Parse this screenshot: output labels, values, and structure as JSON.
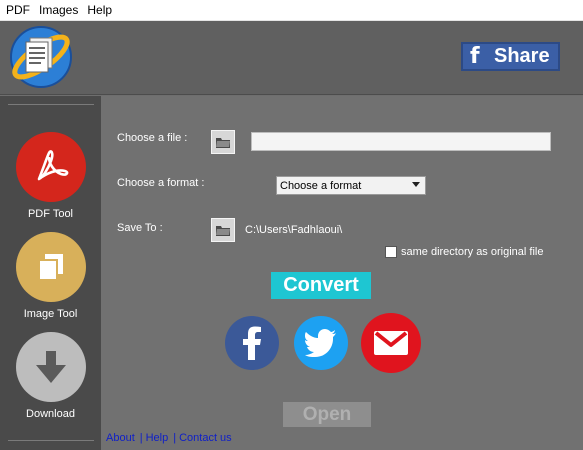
{
  "menu": [
    "PDF",
    "Images",
    "Help"
  ],
  "header": {
    "share_label": "Share",
    "share_icon": "facebook-f-icon"
  },
  "sidebar": {
    "tools": [
      {
        "label": "PDF Tool",
        "icon": "acrobat-icon",
        "color": "#d4261c"
      },
      {
        "label": "Image Tool",
        "icon": "copy-icon",
        "color": "#d8b05a"
      },
      {
        "label": "Download",
        "icon": "download-arrow-icon",
        "color": "#bdbdbd"
      }
    ]
  },
  "form": {
    "choose_file_label": "Choose a file :",
    "file_value": "",
    "choose_format_label": "Choose a format :",
    "format_selected": "Choose a format",
    "save_to_label": "Save To :",
    "save_path": "C:\\Users\\Fadhlaoui\\",
    "same_dir_label": "same directory as original file",
    "same_dir_checked": false
  },
  "actions": {
    "convert_label": "Convert",
    "open_label": "Open"
  },
  "social": [
    {
      "name": "facebook",
      "color": "#3b5998"
    },
    {
      "name": "twitter",
      "color": "#1da1f2"
    },
    {
      "name": "mail",
      "color": "#e0141e"
    }
  ],
  "footer": {
    "about": "About",
    "help": "Help",
    "contact": "Contact us",
    "separator": "|"
  }
}
